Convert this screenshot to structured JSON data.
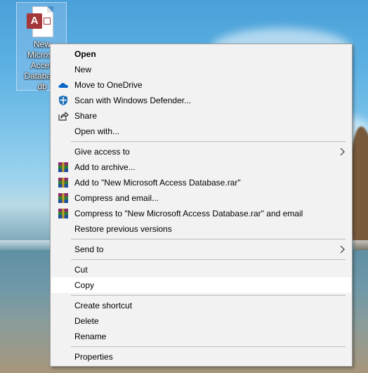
{
  "desktop_icon": {
    "label_lines": [
      "New",
      "Microso",
      "Acces",
      "Database",
      "db"
    ],
    "badge_letter": "A",
    "icon": "access-file-icon"
  },
  "menu": {
    "items": [
      {
        "label": "Open",
        "bold": true,
        "icon": ""
      },
      {
        "label": "New",
        "icon": ""
      },
      {
        "label": "Move to OneDrive",
        "icon": "onedrive-icon"
      },
      {
        "label": "Scan with Windows Defender...",
        "icon": "defender-icon"
      },
      {
        "label": "Share",
        "icon": "share-icon"
      },
      {
        "label": "Open with...",
        "icon": ""
      },
      {
        "label": "Give access to",
        "icon": "",
        "submenu": true
      },
      {
        "label": "Add to archive...",
        "icon": "winrar-icon"
      },
      {
        "label": "Add to \"New Microsoft Access Database.rar\"",
        "icon": "winrar-icon"
      },
      {
        "label": "Compress and email...",
        "icon": "winrar-icon"
      },
      {
        "label": "Compress to \"New Microsoft Access Database.rar\" and email",
        "icon": "winrar-icon"
      },
      {
        "label": "Restore previous versions",
        "icon": ""
      },
      {
        "label": "Send to",
        "icon": "",
        "submenu": true
      },
      {
        "label": "Cut",
        "icon": ""
      },
      {
        "label": "Copy",
        "icon": "",
        "hovered": true
      },
      {
        "label": "Create shortcut",
        "icon": ""
      },
      {
        "label": "Delete",
        "icon": ""
      },
      {
        "label": "Rename",
        "icon": ""
      },
      {
        "label": "Properties",
        "icon": ""
      }
    ]
  },
  "colors": {
    "menu_bg": "#f2f2f2",
    "hover_bg": "#ffffff",
    "access_red": "#a4373a",
    "onedrive_blue": "#0a64c8",
    "defender_blue": "#1c6fb8"
  }
}
